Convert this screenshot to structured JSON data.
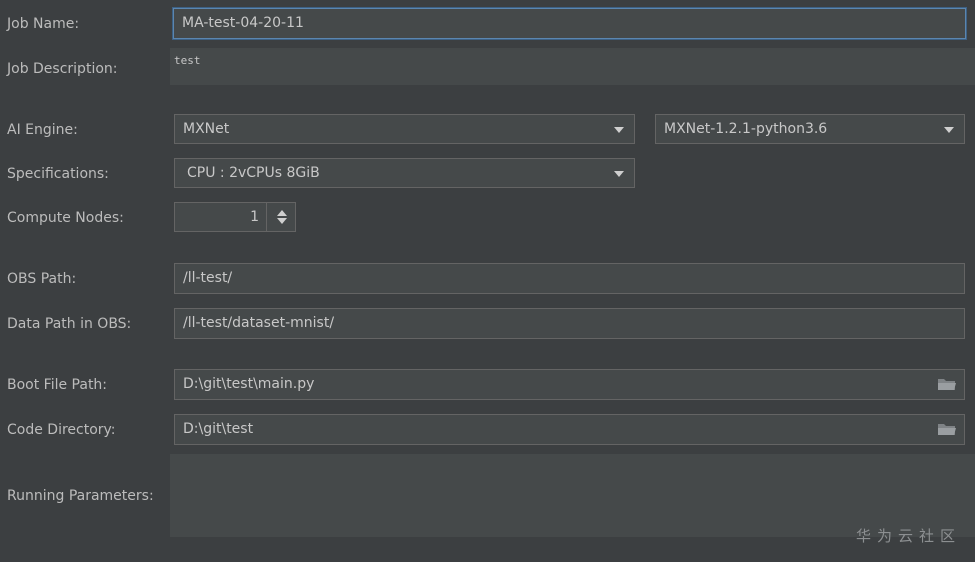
{
  "form": {
    "job_name": {
      "label": "Job Name:",
      "value": "MA-test-04-20-11"
    },
    "job_description": {
      "label": "Job Description:",
      "value": "test"
    },
    "ai_engine": {
      "label": "AI Engine:",
      "engine": "MXNet",
      "version": "MXNet-1.2.1-python3.6"
    },
    "specifications": {
      "label": "Specifications:",
      "value": "CPU : 2vCPUs 8GiB"
    },
    "compute_nodes": {
      "label": "Compute Nodes:",
      "value": "1"
    },
    "obs_path": {
      "label": "OBS Path:",
      "value": "/ll-test/"
    },
    "data_path": {
      "label": "Data Path in OBS:",
      "value": "/ll-test/dataset-mnist/"
    },
    "boot_file": {
      "label": "Boot File Path:",
      "value": "D:\\git\\test\\main.py"
    },
    "code_directory": {
      "label": "Code Directory:",
      "value": "D:\\git\\test"
    },
    "running_parameters": {
      "label": "Running Parameters:",
      "value": ""
    }
  },
  "watermark": "华为云社区",
  "icons": {
    "dropdown": "chevron-down-icon",
    "folder": "folder-icon",
    "spinner": "spinner-arrows-icon"
  },
  "colors": {
    "background": "#3c3f41",
    "field": "#45494a",
    "focus_border": "#5b86b0"
  }
}
